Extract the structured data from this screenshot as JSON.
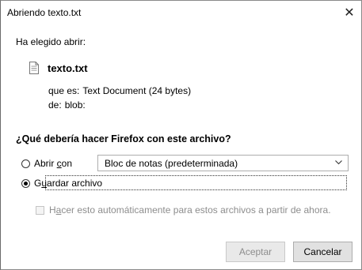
{
  "window": {
    "title": "Abriendo texto.txt",
    "close_glyph": "✕"
  },
  "intro": "Ha elegido abrir:",
  "file": {
    "name": "texto.txt",
    "icon": "text-file-icon",
    "type_label": "que es:",
    "type_value": "Text Document (24 bytes)",
    "from_label": "de:",
    "from_value": "blob:"
  },
  "question": "¿Qué debería hacer Firefox con este archivo?",
  "options": {
    "open_with": {
      "label_pre": "Abrir ",
      "label_underline": "c",
      "label_post": "on",
      "selected": false,
      "app": "Bloc de notas (predeterminada)"
    },
    "save": {
      "label_pre": "G",
      "label_underline": "u",
      "label_post": "ardar archivo",
      "selected": true
    }
  },
  "auto_checkbox": {
    "label_pre": "H",
    "label_underline": "a",
    "label_post": "cer esto automáticamente para estos archivos a partir de ahora.",
    "checked": false,
    "enabled": false
  },
  "buttons": {
    "accept": "Aceptar",
    "cancel": "Cancelar"
  }
}
